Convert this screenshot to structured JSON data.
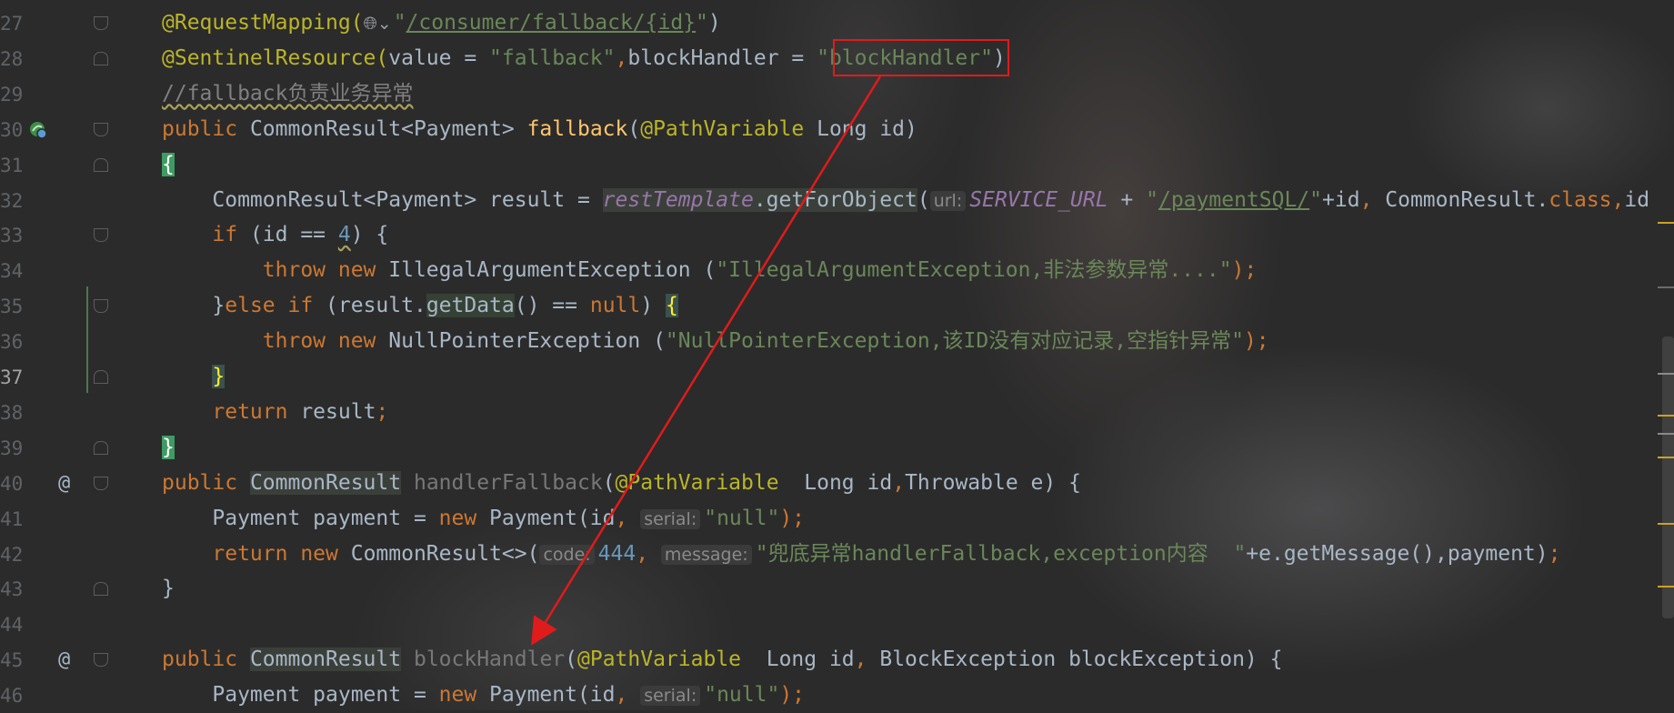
{
  "editor": {
    "current_line": "37",
    "lines": [
      {
        "num": "27",
        "tokens": [
          {
            "t": "@RequestMapping(",
            "c": "a"
          },
          {
            "t": "🌐︎⌄",
            "c": "globe"
          },
          {
            "t": "\"",
            "c": "s"
          },
          {
            "t": "/consumer/fallback/{id}",
            "c": "u"
          },
          {
            "t": "\"",
            "c": "s"
          },
          {
            "t": ")",
            "c": "d"
          }
        ]
      },
      {
        "num": "28",
        "tokens": [
          {
            "t": "@SentinelResource(",
            "c": "a"
          },
          {
            "t": "value = ",
            "c": "d"
          },
          {
            "t": "\"fallback\"",
            "c": "s"
          },
          {
            "t": ",",
            "c": "k"
          },
          {
            "t": "blockHandler = ",
            "c": "d"
          },
          {
            "t": "\"blockHandler\"",
            "c": "s"
          },
          {
            "t": ")",
            "c": "d"
          }
        ]
      },
      {
        "num": "29",
        "tokens": [
          {
            "t": "//fallback负责业务异常",
            "c": "c squig"
          }
        ]
      },
      {
        "num": "30",
        "tokens": [
          {
            "t": "public ",
            "c": "k"
          },
          {
            "t": "CommonResult<Payment> ",
            "c": "d"
          },
          {
            "t": "fallback",
            "c": "f"
          },
          {
            "t": "(",
            "c": "d"
          },
          {
            "t": "@PathVariable ",
            "c": "a"
          },
          {
            "t": "Long id)",
            "c": "d"
          }
        ]
      },
      {
        "num": "31",
        "tokens": [
          {
            "t": "{",
            "c": "hl-green"
          }
        ]
      },
      {
        "num": "32",
        "tokens": [
          {
            "t": "    CommonResult<Payment> result = ",
            "c": "d"
          },
          {
            "t": "restTemplate",
            "c": "i hl-type"
          },
          {
            "t": ".getForObject",
            "c": "d hl-type"
          },
          {
            "t": "(",
            "c": "d"
          },
          {
            "t": "url:",
            "c": "hint"
          },
          {
            "t": "SERVICE_URL",
            "c": "i"
          },
          {
            "t": " + ",
            "c": "d"
          },
          {
            "t": "\"",
            "c": "s"
          },
          {
            "t": "/paymentSQL/",
            "c": "u"
          },
          {
            "t": "\"",
            "c": "s"
          },
          {
            "t": "+id",
            "c": "d"
          },
          {
            "t": ", ",
            "c": "k"
          },
          {
            "t": "CommonResult.",
            "c": "d"
          },
          {
            "t": "class",
            "c": "k"
          },
          {
            "t": ",",
            "c": "k"
          },
          {
            "t": "id",
            "c": "d"
          }
        ]
      },
      {
        "num": "33",
        "tokens": [
          {
            "t": "    ",
            "c": "d"
          },
          {
            "t": "if ",
            "c": "k"
          },
          {
            "t": "(id == ",
            "c": "d"
          },
          {
            "t": "4",
            "c": "n squig"
          },
          {
            "t": ") {",
            "c": "d"
          }
        ]
      },
      {
        "num": "34",
        "tokens": [
          {
            "t": "        ",
            "c": "d"
          },
          {
            "t": "throw new ",
            "c": "k"
          },
          {
            "t": "IllegalArgumentException ",
            "c": "d"
          },
          {
            "t": "(",
            "c": "d"
          },
          {
            "t": "\"IllegalArgumentException,非法参数异常....\"",
            "c": "s"
          },
          {
            "t": ");",
            "c": "k"
          }
        ]
      },
      {
        "num": "35",
        "tokens": [
          {
            "t": "    ",
            "c": "d"
          },
          {
            "t": "}",
            "c": "d"
          },
          {
            "t": "else if ",
            "c": "k"
          },
          {
            "t": "(result.",
            "c": "d"
          },
          {
            "t": "getData",
            "c": "d hl-ref"
          },
          {
            "t": "() == ",
            "c": "d"
          },
          {
            "t": "null",
            "c": "k"
          },
          {
            "t": ") ",
            "c": "d"
          },
          {
            "t": "{",
            "c": "hl-brace"
          }
        ]
      },
      {
        "num": "36",
        "tokens": [
          {
            "t": "        ",
            "c": "d"
          },
          {
            "t": "throw new ",
            "c": "k"
          },
          {
            "t": "NullPointerException ",
            "c": "d"
          },
          {
            "t": "(",
            "c": "d"
          },
          {
            "t": "\"NullPointerException,该ID没有对应记录,空指针异常\"",
            "c": "s"
          },
          {
            "t": ");",
            "c": "k"
          }
        ]
      },
      {
        "num": "37",
        "tokens": [
          {
            "t": "    ",
            "c": "d"
          },
          {
            "t": "}",
            "c": "hl-brace"
          }
        ]
      },
      {
        "num": "38",
        "tokens": [
          {
            "t": "    ",
            "c": "d"
          },
          {
            "t": "return ",
            "c": "k"
          },
          {
            "t": "result",
            "c": "d"
          },
          {
            "t": ";",
            "c": "k"
          }
        ]
      },
      {
        "num": "39",
        "tokens": [
          {
            "t": "}",
            "c": "hl-green"
          }
        ]
      },
      {
        "num": "40",
        "tokens": [
          {
            "t": "public ",
            "c": "k"
          },
          {
            "t": "CommonResult",
            "c": "d hl-type"
          },
          {
            "t": " ",
            "c": "d"
          },
          {
            "t": "handlerFallback",
            "c": "g"
          },
          {
            "t": "(",
            "c": "d"
          },
          {
            "t": "@PathVariable ",
            "c": "a"
          },
          {
            "t": " Long id",
            "c": "d"
          },
          {
            "t": ",",
            "c": "k"
          },
          {
            "t": "Throwable e) {",
            "c": "d"
          }
        ]
      },
      {
        "num": "41",
        "tokens": [
          {
            "t": "    Payment payment = ",
            "c": "d"
          },
          {
            "t": "new ",
            "c": "k"
          },
          {
            "t": "Payment(id",
            "c": "d"
          },
          {
            "t": ", ",
            "c": "k"
          },
          {
            "t": "serial:",
            "c": "hint"
          },
          {
            "t": "\"null\"",
            "c": "s"
          },
          {
            "t": ");",
            "c": "k"
          }
        ]
      },
      {
        "num": "42",
        "tokens": [
          {
            "t": "    ",
            "c": "d"
          },
          {
            "t": "return new ",
            "c": "k"
          },
          {
            "t": "CommonResult<>(",
            "c": "d"
          },
          {
            "t": "code:",
            "c": "hint"
          },
          {
            "t": "444",
            "c": "n"
          },
          {
            "t": ", ",
            "c": "k"
          },
          {
            "t": "message:",
            "c": "hint"
          },
          {
            "t": "\"兜底异常handlerFallback,exception内容  \"",
            "c": "s"
          },
          {
            "t": "+e.getMessage(),payment)",
            "c": "d"
          },
          {
            "t": ";",
            "c": "k"
          }
        ]
      },
      {
        "num": "43",
        "tokens": [
          {
            "t": "}",
            "c": "d"
          }
        ]
      },
      {
        "num": "44",
        "tokens": []
      },
      {
        "num": "45",
        "tokens": [
          {
            "t": "public ",
            "c": "k"
          },
          {
            "t": "CommonResult",
            "c": "d hl-type"
          },
          {
            "t": " ",
            "c": "d"
          },
          {
            "t": "blockHandler",
            "c": "g"
          },
          {
            "t": "(",
            "c": "d"
          },
          {
            "t": "@PathVariable ",
            "c": "a"
          },
          {
            "t": " Long id",
            "c": "d"
          },
          {
            "t": ", ",
            "c": "k"
          },
          {
            "t": "BlockException blockException) {",
            "c": "d"
          }
        ]
      },
      {
        "num": "46",
        "tokens": [
          {
            "t": "    Payment payment = ",
            "c": "d"
          },
          {
            "t": "new ",
            "c": "k"
          },
          {
            "t": "Payment(id",
            "c": "d"
          },
          {
            "t": ", ",
            "c": "k"
          },
          {
            "t": "serial:",
            "c": "hint"
          },
          {
            "t": "\"null\"",
            "c": "s"
          },
          {
            "t": ");",
            "c": "k"
          }
        ]
      }
    ]
  },
  "gutter": {
    "bean_icon": "spring-bean-icon",
    "override_icon": "@",
    "override_lines": [
      "40",
      "45"
    ],
    "fold_down_lines": [
      "27",
      "30",
      "33",
      "35",
      "40",
      "45"
    ],
    "fold_up_lines": [
      "28",
      "31",
      "37",
      "39",
      "43"
    ]
  },
  "annotation": {
    "box_color": "#e01b1b",
    "arrow_color": "#e01b1b"
  }
}
